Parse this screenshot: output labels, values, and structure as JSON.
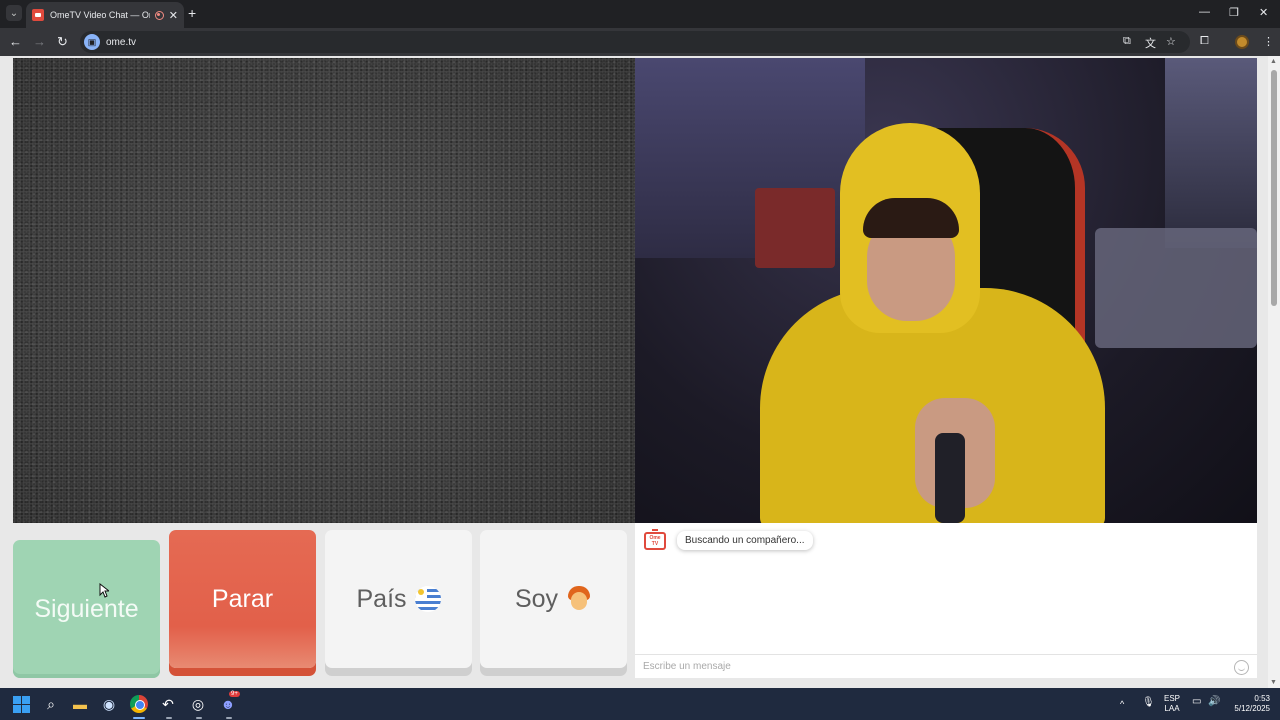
{
  "browser": {
    "tab_title": "OmeTV Video Chat — Omegle...",
    "url": "ome.tv",
    "icons": [
      "tab-search-icon",
      "ometv-favicon",
      "recording-icon",
      "close-tab-icon",
      "new-tab-icon",
      "minimize-icon",
      "restore-icon",
      "close-window-icon",
      "back-icon",
      "forward-icon",
      "reload-icon",
      "site-info-icon",
      "install-icon",
      "translate-icon",
      "bookmark-star-icon",
      "extensions-icon",
      "profile-icon",
      "menu-icon"
    ]
  },
  "controls": {
    "next_label": "Siguiente",
    "stop_label": "Parar",
    "country_label": "País",
    "me_label": "Soy",
    "country_flag": "uruguay-flag-icon",
    "gender_icon": "boy-emoji-icon"
  },
  "chat": {
    "logo_text": "Ome TV",
    "status_message": "Buscando un compañero...",
    "input_placeholder": "Escribe un mensaje"
  },
  "taskbar": {
    "language": "ESP",
    "keyboard_layout": "LAA",
    "time": "0:53",
    "date": "5/12/2025",
    "discord_badge": "9+"
  },
  "colors": {
    "next": "#9fd4b3",
    "stop": "#e2604a",
    "neutral_button": "#f4f4f4",
    "brand": "#e04a3d"
  }
}
